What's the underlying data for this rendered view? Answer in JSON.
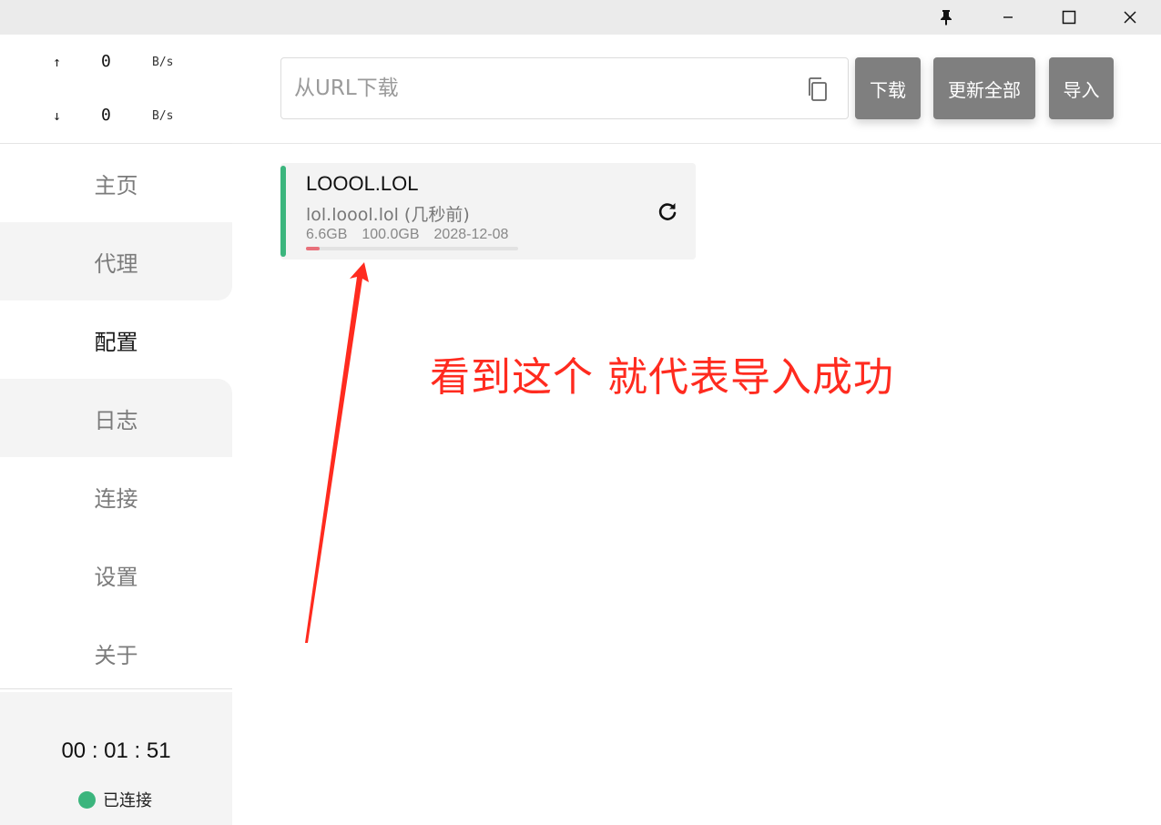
{
  "window": {
    "controls": {
      "pin": "pin-icon",
      "minimize": "minimize-icon",
      "maximize": "maximize-icon",
      "close": "close-icon"
    }
  },
  "sidebar": {
    "speed": {
      "up": {
        "arrow": "↑",
        "value": "0",
        "unit": "B/s"
      },
      "down": {
        "arrow": "↓",
        "value": "0",
        "unit": "B/s"
      }
    },
    "nav": [
      {
        "id": "home",
        "label": "主页"
      },
      {
        "id": "proxy",
        "label": "代理"
      },
      {
        "id": "profiles",
        "label": "配置"
      },
      {
        "id": "logs",
        "label": "日志"
      },
      {
        "id": "connections",
        "label": "连接"
      },
      {
        "id": "settings",
        "label": "设置"
      },
      {
        "id": "about",
        "label": "关于"
      }
    ],
    "active_nav": "profiles",
    "footer": {
      "timer": "00 : 01 : 51",
      "status": "已连接",
      "status_color": "#3bb57d"
    }
  },
  "main": {
    "url_input": {
      "placeholder": "从URL下载",
      "value": ""
    },
    "buttons": {
      "download": "下载",
      "update_all": "更新全部",
      "import": "导入"
    },
    "profile": {
      "title": "LOOOL.LOL",
      "subtitle": "lol.loool.lol (几秒前)",
      "used": "6.6GB",
      "total": "100.0GB",
      "expire": "2028-12-08",
      "usage_fraction": 0.066,
      "accent_color": "#3bb57d",
      "progress_color": "#e8707a"
    }
  },
  "annotation": {
    "text": "看到这个 就代表导入成功",
    "color": "#ff2b1f"
  }
}
